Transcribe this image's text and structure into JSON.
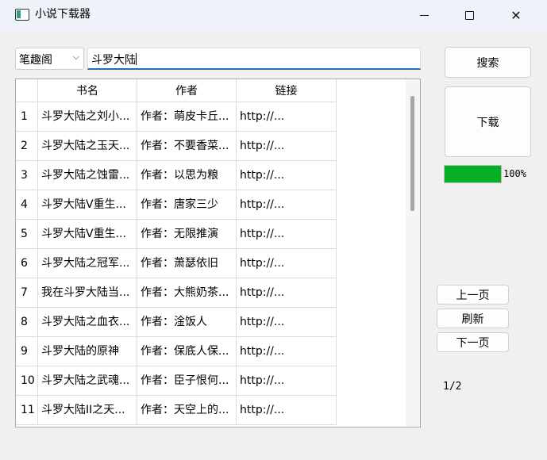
{
  "window": {
    "title": "小说下载器",
    "minimize_symbol": "—",
    "close_symbol": "✕"
  },
  "source_select": {
    "value": "笔趣阁",
    "chevron": "⌵"
  },
  "search": {
    "value": "斗罗大陆"
  },
  "buttons": {
    "search": "搜索",
    "download": "下载",
    "prev": "上一页",
    "refresh": "刷新",
    "next": "下一页"
  },
  "progress": {
    "value": 1.0,
    "text": "100%",
    "color": "#06b025"
  },
  "pagination": {
    "text": "1/2"
  },
  "table": {
    "columns": [
      "书名",
      "作者",
      "链接"
    ],
    "rows": [
      {
        "n": "1",
        "name": "斗罗大陆之刘小...",
        "author": "作者：萌皮卡丘...",
        "link": "http://..."
      },
      {
        "n": "2",
        "name": "斗罗大陆之玉天...",
        "author": "作者：不要香菜...",
        "link": "http://..."
      },
      {
        "n": "3",
        "name": "斗罗大陆之蚀雷...",
        "author": "作者：以思为粮",
        "link": "http://..."
      },
      {
        "n": "4",
        "name": "斗罗大陆V重生...",
        "author": "作者：唐家三少",
        "link": "http://..."
      },
      {
        "n": "5",
        "name": "斗罗大陆V重生...",
        "author": "作者：无限推演",
        "link": "http://..."
      },
      {
        "n": "6",
        "name": "斗罗大陆之冠军...",
        "author": "作者：萧瑟依旧",
        "link": "http://..."
      },
      {
        "n": "7",
        "name": "我在斗罗大陆当...",
        "author": "作者：大熊奶茶...",
        "link": "http://..."
      },
      {
        "n": "8",
        "name": "斗罗大陆之血衣...",
        "author": "作者：淦饭人",
        "link": "http://..."
      },
      {
        "n": "9",
        "name": "斗罗大陆的原神",
        "author": "作者：保底人保...",
        "link": "http://..."
      },
      {
        "n": "10",
        "name": "斗罗大陆之武魂...",
        "author": "作者：臣子恨何...",
        "link": "http://..."
      },
      {
        "n": "11",
        "name": "斗罗大陆II之天...",
        "author": "作者：天空上的...",
        "link": "http://..."
      }
    ]
  }
}
